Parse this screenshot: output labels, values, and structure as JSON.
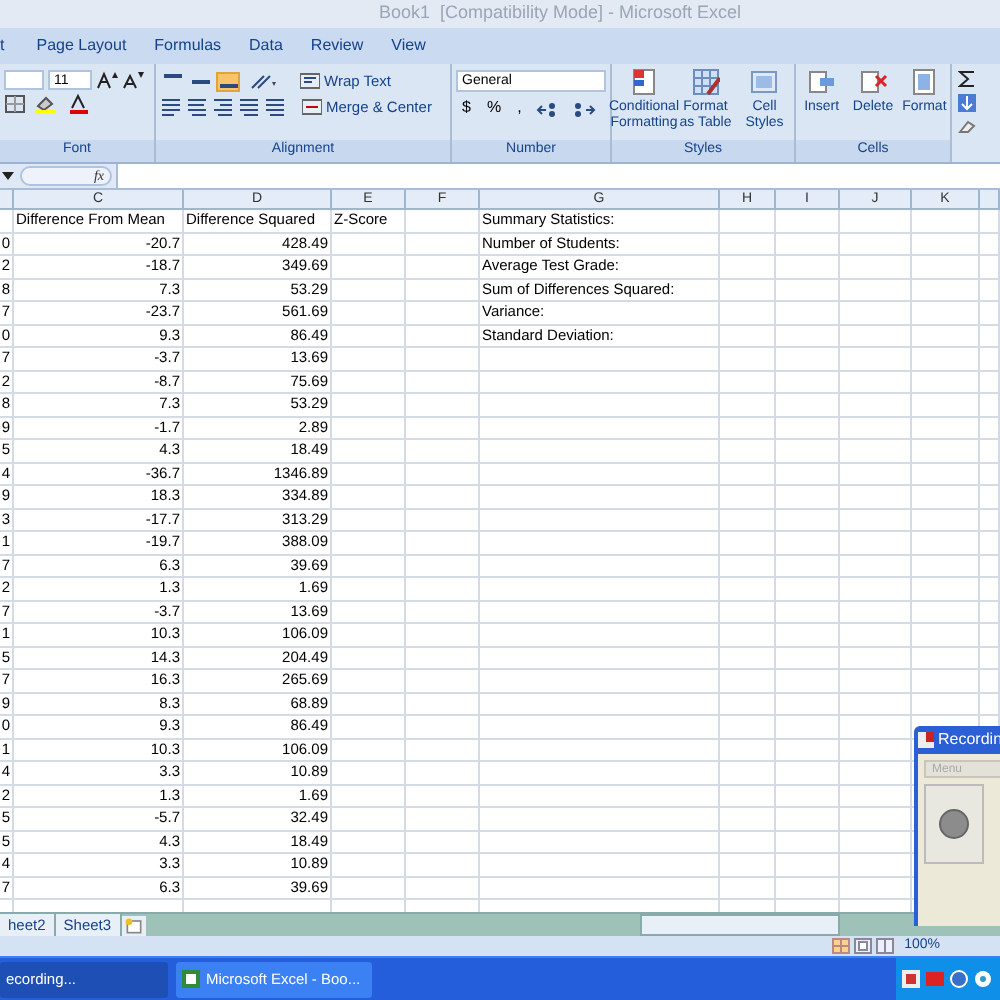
{
  "window": {
    "title": "Book1  [Compatibility Mode] - Microsoft Excel"
  },
  "ribbon_tabs": [
    "t",
    "Page Layout",
    "Formulas",
    "Data",
    "Review",
    "View"
  ],
  "ribbon": {
    "font": {
      "size": "11",
      "label": "Font"
    },
    "alignment": {
      "vertical_align": [
        {
          "selected": false
        },
        {
          "selected": false
        },
        {
          "selected": true
        }
      ],
      "wrap": "Wrap Text",
      "merge": "Merge & Center",
      "label": "Alignment"
    },
    "number": {
      "format": "General",
      "buttons": [
        "$",
        "%",
        ","
      ],
      "label": "Number"
    },
    "styles": {
      "buttons": [
        "Conditional Formatting",
        "Format as Table",
        "Cell Styles"
      ],
      "label": "Styles"
    },
    "cells": {
      "buttons": [
        "Insert",
        "Delete",
        "Format"
      ],
      "label": "Cells"
    }
  },
  "formula_bar": {
    "fx": "fx"
  },
  "columns": [
    "C",
    "D",
    "E",
    "F",
    "G",
    "H",
    "I",
    "J",
    "K"
  ],
  "rows": [
    {
      "c": "Difference From Mean",
      "d": "Difference Squared",
      "e": "Z-Score",
      "g": "Summary Statistics:"
    },
    {
      "b": "0",
      "c": "-20.7",
      "d": "428.49",
      "g": "Number of Students:"
    },
    {
      "b": "2",
      "c": "-18.7",
      "d": "349.69",
      "g": "Average Test Grade:"
    },
    {
      "b": "8",
      "c": "7.3",
      "d": "53.29",
      "g": "Sum of Differences Squared:"
    },
    {
      "b": "7",
      "c": "-23.7",
      "d": "561.69",
      "g": "Variance:"
    },
    {
      "b": "0",
      "c": "9.3",
      "d": "86.49",
      "g": "Standard Deviation:"
    },
    {
      "b": "7",
      "c": "-3.7",
      "d": "13.69"
    },
    {
      "b": "2",
      "c": "-8.7",
      "d": "75.69"
    },
    {
      "b": "8",
      "c": "7.3",
      "d": "53.29"
    },
    {
      "b": "9",
      "c": "-1.7",
      "d": "2.89"
    },
    {
      "b": "5",
      "c": "4.3",
      "d": "18.49"
    },
    {
      "b": "4",
      "c": "-36.7",
      "d": "1346.89"
    },
    {
      "b": "9",
      "c": "18.3",
      "d": "334.89"
    },
    {
      "b": "3",
      "c": "-17.7",
      "d": "313.29"
    },
    {
      "b": "1",
      "c": "-19.7",
      "d": "388.09"
    },
    {
      "b": "7",
      "c": "6.3",
      "d": "39.69"
    },
    {
      "b": "2",
      "c": "1.3",
      "d": "1.69"
    },
    {
      "b": "7",
      "c": "-3.7",
      "d": "13.69"
    },
    {
      "b": "1",
      "c": "10.3",
      "d": "106.09"
    },
    {
      "b": "5",
      "c": "14.3",
      "d": "204.49"
    },
    {
      "b": "7",
      "c": "16.3",
      "d": "265.69"
    },
    {
      "b": "9",
      "c": "8.3",
      "d": "68.89"
    },
    {
      "b": "0",
      "c": "9.3",
      "d": "86.49"
    },
    {
      "b": "1",
      "c": "10.3",
      "d": "106.09"
    },
    {
      "b": "4",
      "c": "3.3",
      "d": "10.89"
    },
    {
      "b": "2",
      "c": "1.3",
      "d": "1.69"
    },
    {
      "b": "5",
      "c": "-5.7",
      "d": "32.49"
    },
    {
      "b": "5",
      "c": "4.3",
      "d": "18.49"
    },
    {
      "b": "4",
      "c": "3.3",
      "d": "10.89"
    },
    {
      "b": "7",
      "c": "6.3",
      "d": "39.69"
    }
  ],
  "sheet_tabs": [
    "heet2",
    "Sheet3"
  ],
  "status_bar": {
    "zoom": "100%"
  },
  "recording_window": {
    "title": "Recordin",
    "menu": "Menu"
  },
  "taskbar": [
    "ecording...",
    "Microsoft Excel - Boo..."
  ]
}
